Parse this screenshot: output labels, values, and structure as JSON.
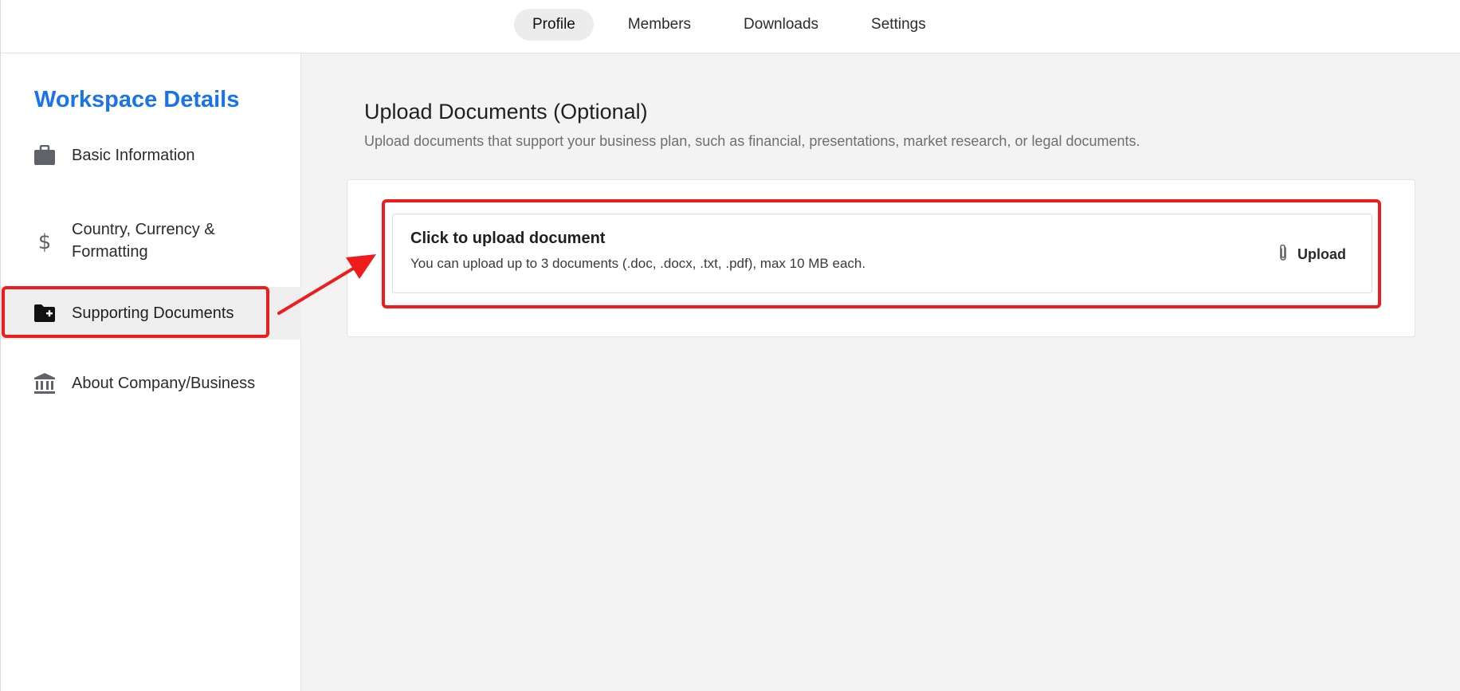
{
  "topnav": {
    "tabs": [
      {
        "label": "Profile",
        "active": true
      },
      {
        "label": "Members",
        "active": false
      },
      {
        "label": "Downloads",
        "active": false
      },
      {
        "label": "Settings",
        "active": false
      }
    ]
  },
  "sidebar": {
    "title": "Workspace Details",
    "items": [
      {
        "label": "Basic Information",
        "icon": "briefcase-icon"
      },
      {
        "label": "Country, Currency & Formatting",
        "icon": "dollar-icon"
      },
      {
        "label": "Supporting Documents",
        "icon": "folder-plus-icon",
        "selected": true
      },
      {
        "label": "About Company/Business",
        "icon": "bank-icon"
      }
    ]
  },
  "main": {
    "title": "Upload Documents (Optional)",
    "subtitle": "Upload documents that support your business plan, such as financial, presentations, market research, or legal documents.",
    "upload": {
      "title": "Click to upload document",
      "hint": "You can upload up to 3 documents (.doc, .docx, .txt, .pdf), max 10 MB each.",
      "button_label": "Upload",
      "button_icon": "paperclip-icon"
    }
  },
  "colors": {
    "accent": "#1a73e8",
    "annotation": "#ee1c1c",
    "main_bg": "#f2f3f2"
  }
}
